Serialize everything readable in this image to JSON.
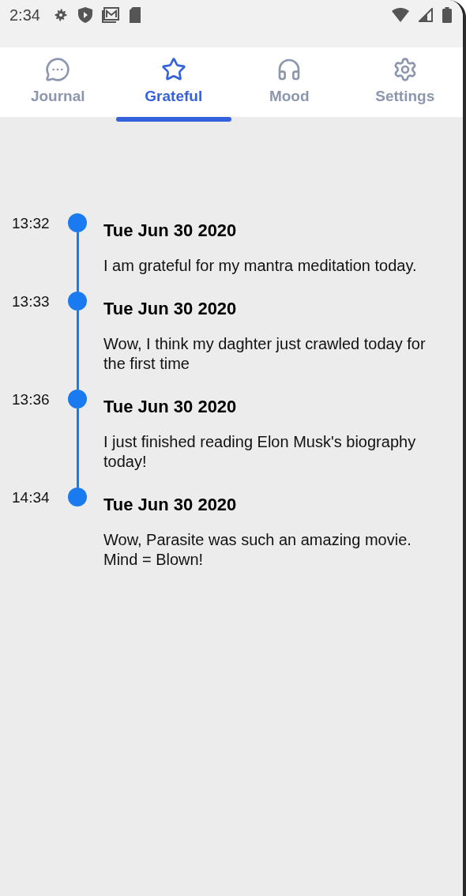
{
  "status_bar": {
    "time": "2:34"
  },
  "tabs": [
    {
      "label": "Journal",
      "selected": false
    },
    {
      "label": "Grateful",
      "selected": true
    },
    {
      "label": "Mood",
      "selected": false
    },
    {
      "label": "Settings",
      "selected": false
    }
  ],
  "entries": [
    {
      "time": "13:32",
      "date": "Tue Jun 30 2020",
      "text": "I am grateful for my mantra meditation today."
    },
    {
      "time": "13:33",
      "date": "Tue Jun 30 2020",
      "text": "Wow, I think my daghter just crawled today for the first time"
    },
    {
      "time": "13:36",
      "date": "Tue Jun 30 2020",
      "text": "I just finished reading Elon Musk's biography today!"
    },
    {
      "time": "14:34",
      "date": "Tue Jun 30 2020",
      "text": "Wow, Parasite was such an amazing movie. Mind = Blown!"
    }
  ]
}
